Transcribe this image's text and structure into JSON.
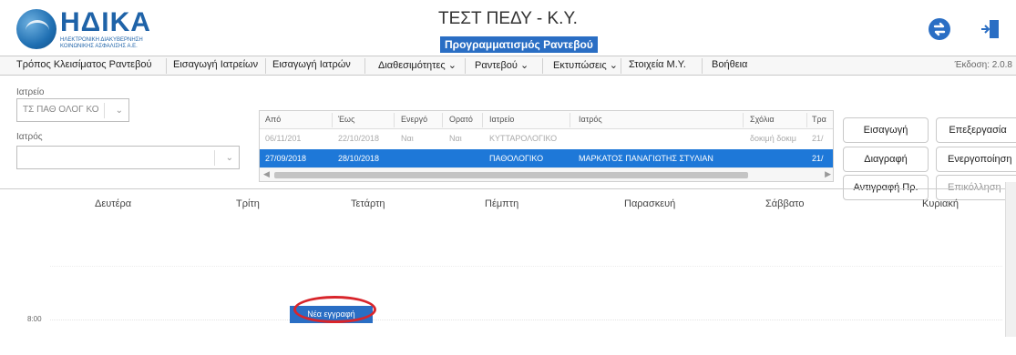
{
  "header": {
    "logo_text": "ΗΔΙΚΑ",
    "logo_sub1": "ΗΛΕΚΤΡΟΝΙΚΗ ΔΙΑΚΥΒΕΡΝΗΣΗ",
    "logo_sub2": "ΚΟΙΝΩΝΙΚΗΣ ΑΣΦΑΛΙΣΗΣ Α.Ε.",
    "title": "ΤΕΣΤ ΠΕΔΥ - Κ.Υ.",
    "subtitle": "Προγραμματισμός Ραντεβού"
  },
  "menu": {
    "items": [
      {
        "label": "Τρόπος Κλεισίματος Ραντεβού"
      },
      {
        "label": "Εισαγωγή Ιατρείων"
      },
      {
        "label": "Εισαγωγή Ιατρών"
      },
      {
        "label": "Διαθεσιμότητες ⌄"
      },
      {
        "label": "Ραντεβού ⌄"
      },
      {
        "label": "Εκτυπώσεις ⌄"
      },
      {
        "label": "Στοιχεία Μ.Υ."
      },
      {
        "label": "Βοήθεια"
      }
    ],
    "version": "Έκδοση: 2.0.8"
  },
  "filters": {
    "clinic_label": "Ιατρείο",
    "clinic_value": "ΤΣ ΠΑΘ ΟΛΟΓ ΚΟ",
    "doctor_label": "Ιατρός",
    "doctor_value": ""
  },
  "grid": {
    "columns": [
      "Από",
      "Έως",
      "Ενεργό",
      "Ορατό",
      "Ιατρείο",
      "Ιατρός",
      "Σχόλια",
      "Τρα"
    ],
    "rows": [
      {
        "from": "06/11/201",
        "to": "22/10/2018",
        "active": "Ναι",
        "visible": "Ναι",
        "clinic": "ΚΥΤΤΑΡΟΛΟΓΙΚΟ",
        "doctor": "",
        "comments": "δοκιμή δοκιμ",
        "extra": "21/"
      },
      {
        "from": "27/09/2018",
        "to": "28/10/2018",
        "active": "",
        "visible": "",
        "clinic": "ΠΑΘΟΛΟΓΙΚΟ",
        "doctor": "ΜΑΡΚΑΤΟΣ ΠΑΝΑΓΙΩΤΗΣ ΣΤΥΛΙΑΝ",
        "comments": "",
        "extra": "21/"
      }
    ]
  },
  "buttons": {
    "insert": "Εισαγωγή",
    "edit": "Επεξεργασία",
    "delete": "Διαγραφή",
    "activate": "Ενεργοποίηση",
    "copy": "Αντιγραφή Πρ.",
    "paste": "Επικόλληση Πρ."
  },
  "calendar": {
    "days": [
      "Δευτέρα",
      "Τρίτη",
      "Τετάρτη",
      "Πέμπτη",
      "Παρασκευή",
      "Σάββατο",
      "Κυριακή"
    ],
    "time_label": "8:00",
    "new_entry": "Νέα εγγραφή"
  },
  "colors": {
    "accent": "#2a6ec4",
    "selection": "#1e78d8",
    "highlight_ring": "#d8252b"
  }
}
